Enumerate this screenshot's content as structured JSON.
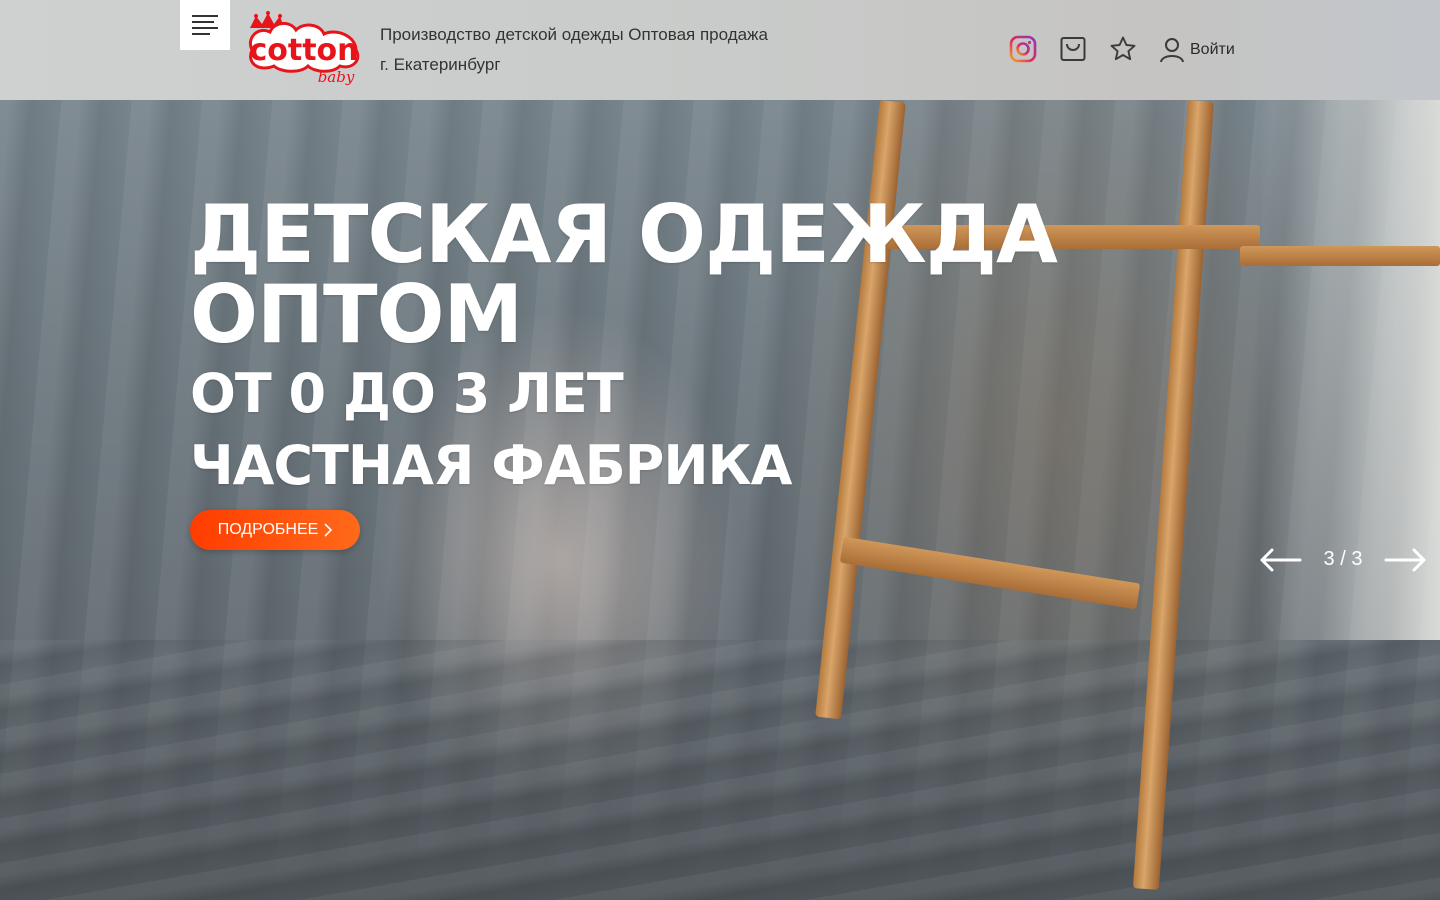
{
  "header": {
    "tagline_line1": "Производство детской одежды Оптовая продажа",
    "tagline_line2": "г. Екатеринбург",
    "login_label": "Войти",
    "icons": [
      "menu-icon",
      "instagram-icon",
      "cart-icon",
      "star-icon",
      "user-icon"
    ]
  },
  "logo": {
    "word": "cotton",
    "subword": "baby",
    "color": "#e8141c"
  },
  "hero": {
    "line1": "ДЕТСКАЯ ОДЕЖДА",
    "line2": "ОПТОМ",
    "line3": "ОТ 0 ДО 3 ЛЕТ",
    "line4": "ЧАСТНАЯ ФАБРИКА",
    "button_label": "ПОДРОБНЕЕ",
    "button_color": "#ff4a0a"
  },
  "slider": {
    "counter": "3 / 3"
  }
}
